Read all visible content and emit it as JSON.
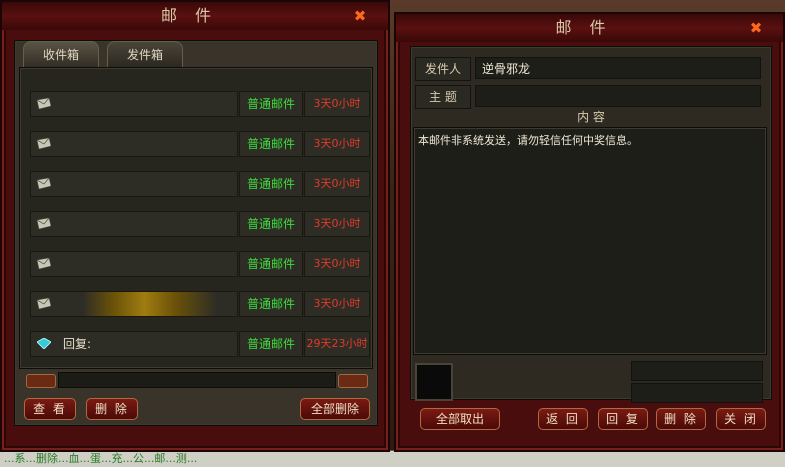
{
  "left_window": {
    "title": "邮件",
    "tabs": [
      {
        "label": "收件箱"
      },
      {
        "label": "发件箱"
      }
    ],
    "mails": [
      {
        "type": "普通邮件",
        "time": "3天0小时",
        "reply": ""
      },
      {
        "type": "普通邮件",
        "time": "3天0小时",
        "reply": ""
      },
      {
        "type": "普通邮件",
        "time": "3天0小时",
        "reply": ""
      },
      {
        "type": "普通邮件",
        "time": "3天0小时",
        "reply": ""
      },
      {
        "type": "普通邮件",
        "time": "3天0小时",
        "reply": ""
      },
      {
        "type": "普通邮件",
        "time": "3天0小时",
        "reply": ""
      },
      {
        "type": "普通邮件",
        "time": "29天23小时",
        "reply": "回复:"
      }
    ],
    "buttons": {
      "view": "查 看",
      "delete": "删 除",
      "delete_all": "全部删除"
    }
  },
  "right_window": {
    "title": "邮件",
    "sender_label": "发件人",
    "sender_value": "逆骨邪龙",
    "subject_label": "主 题",
    "subject_value": "",
    "content_label": "内 容",
    "content": "本邮件非系统发送，请勿轻信任何中奖信息。",
    "buttons": {
      "take_all": "全部取出",
      "back": "返 回",
      "reply": "回 复",
      "delete": "删 除",
      "close": "关 闭"
    }
  },
  "bottom_strip": {
    "text": "...系...删除...血...蛋...充...公...邮...测..."
  },
  "colors": {
    "mail_type_green": "#3edd3e",
    "time_red": "#e23a2a",
    "close_orange": "#ff6a1a"
  }
}
